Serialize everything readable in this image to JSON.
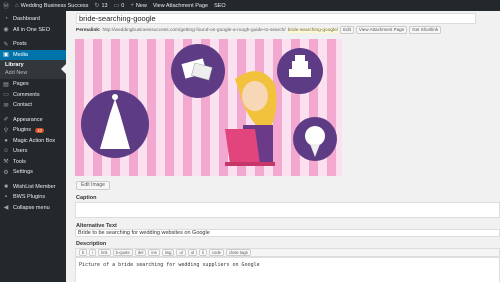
{
  "adminbar": {
    "site_name": "Wedding Business Success",
    "updates": "13",
    "comments": "0",
    "new_label": "New",
    "view_label": "View Attachment Page",
    "seo_label": "SEO"
  },
  "sidebar": {
    "items": [
      {
        "label": "Dashboard",
        "icon": "dashboard-icon"
      },
      {
        "label": "All in One SEO",
        "icon": "seo-icon"
      },
      {
        "label": "Posts",
        "icon": "posts-icon"
      },
      {
        "label": "Media",
        "icon": "media-icon"
      },
      {
        "label": "Pages",
        "icon": "pages-icon"
      },
      {
        "label": "Comments",
        "icon": "comments-icon"
      },
      {
        "label": "Contact",
        "icon": "contact-icon"
      },
      {
        "label": "Appearance",
        "icon": "appearance-icon"
      },
      {
        "label": "Plugins",
        "icon": "plugins-icon",
        "badge": "10"
      },
      {
        "label": "Magic Action Box",
        "icon": "magic-box-icon"
      },
      {
        "label": "Users",
        "icon": "users-icon"
      },
      {
        "label": "Tools",
        "icon": "tools-icon"
      },
      {
        "label": "Settings",
        "icon": "settings-icon"
      },
      {
        "label": "WishList Member",
        "icon": "wishlist-icon"
      },
      {
        "label": "BWS Plugins",
        "icon": "bws-icon"
      },
      {
        "label": "Collapse menu",
        "icon": "collapse-icon"
      }
    ],
    "submenu": [
      "Library",
      "Add New"
    ]
  },
  "main": {
    "title": "bride-searching-google",
    "permalink_label": "Permalink:",
    "permalink_base": "http://weddingbusinesssuccess.com/getting-found-on-google-a-rough-guide-to-search/",
    "permalink_slug": "bride-searching-google/",
    "edit_btn": "Edit",
    "view_btn": "View Attachment Page",
    "shortlink_btn": "Get Shortlink",
    "edit_image": "Edit Image",
    "caption_label": "Caption",
    "caption_value": "",
    "alt_label": "Alternative Text",
    "alt_value": "Bride to be searching for wedding websites on Google",
    "desc_label": "Description",
    "toolbar": [
      "b",
      "i",
      "link",
      "b-quote",
      "del",
      "ins",
      "img",
      "ul",
      "ol",
      "li",
      "code",
      "close tags"
    ],
    "description": "Picture of a bride searching for wedding suppliers on Google"
  },
  "colors": {
    "adminbar_bg": "#23282d",
    "active_menu": "#0073aa",
    "badge": "#d54e21",
    "stripe_pink": "#f3a8d0",
    "circle_purple": "#5d3c85"
  }
}
